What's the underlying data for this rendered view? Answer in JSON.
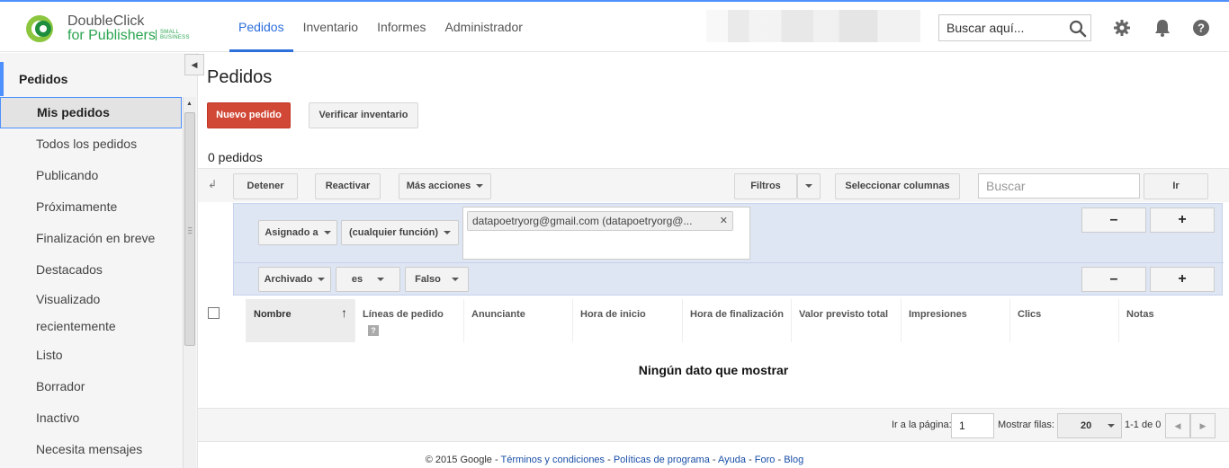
{
  "header": {
    "logo_line1": "DoubleClick",
    "logo_line2": "for Publishers",
    "logo_small1": "SMALL",
    "logo_small2": "BUSINESS",
    "nav": [
      "Pedidos",
      "Inventario",
      "Informes",
      "Administrador"
    ],
    "search_placeholder": "Buscar aquí...",
    "icons": [
      "search-icon",
      "gear-icon",
      "bell-icon",
      "help-icon"
    ],
    "accent_color": "#2d6fdb"
  },
  "sidebar": {
    "heading": "Pedidos",
    "items": [
      "Mis pedidos",
      "Todos los pedidos",
      "Publicando",
      "Próximamente",
      "Finalización en breve",
      "Destacados",
      "Visualizado recientemente",
      "Listo",
      "Borrador",
      "Inactivo",
      "Necesita mensajes"
    ],
    "selected": "Mis pedidos"
  },
  "main": {
    "title": "Pedidos",
    "new_order": "Nuevo pedido",
    "check_inventory": "Verificar inventario",
    "count": "0 pedidos",
    "toolbar": {
      "stop": "Detener",
      "reactivate": "Reactivar",
      "more_actions": "Más acciones",
      "filters": "Filtros",
      "select_columns": "Seleccionar columnas",
      "search_placeholder": "Buscar",
      "go": "Ir"
    },
    "filters": {
      "assigned": "Asignado a",
      "any_role": "(cualquier función)",
      "chip": "datapoetryorg@gmail.com (datapoetryorg@...",
      "archived": "Archivado",
      "is": "es",
      "false": "Falso",
      "minus": "–",
      "plus": "+"
    },
    "columns": [
      "Nombre",
      "Líneas de pedido",
      "Anunciante",
      "Hora de inicio",
      "Hora de finalización",
      "Valor previsto total",
      "Impresiones",
      "Clics",
      "Notas"
    ],
    "empty": "Ningún dato que mostrar",
    "pager": {
      "goto_label": "Ir a la página:",
      "goto_value": "1",
      "rows_label": "Mostrar filas:",
      "rows_value": "20",
      "range": "1-1 de 0"
    }
  },
  "footer": {
    "copyright": "© 2015 Google - ",
    "links": [
      "Términos y condiciones",
      "Políticas de programa",
      "Ayuda",
      "Foro",
      "Blog"
    ]
  }
}
